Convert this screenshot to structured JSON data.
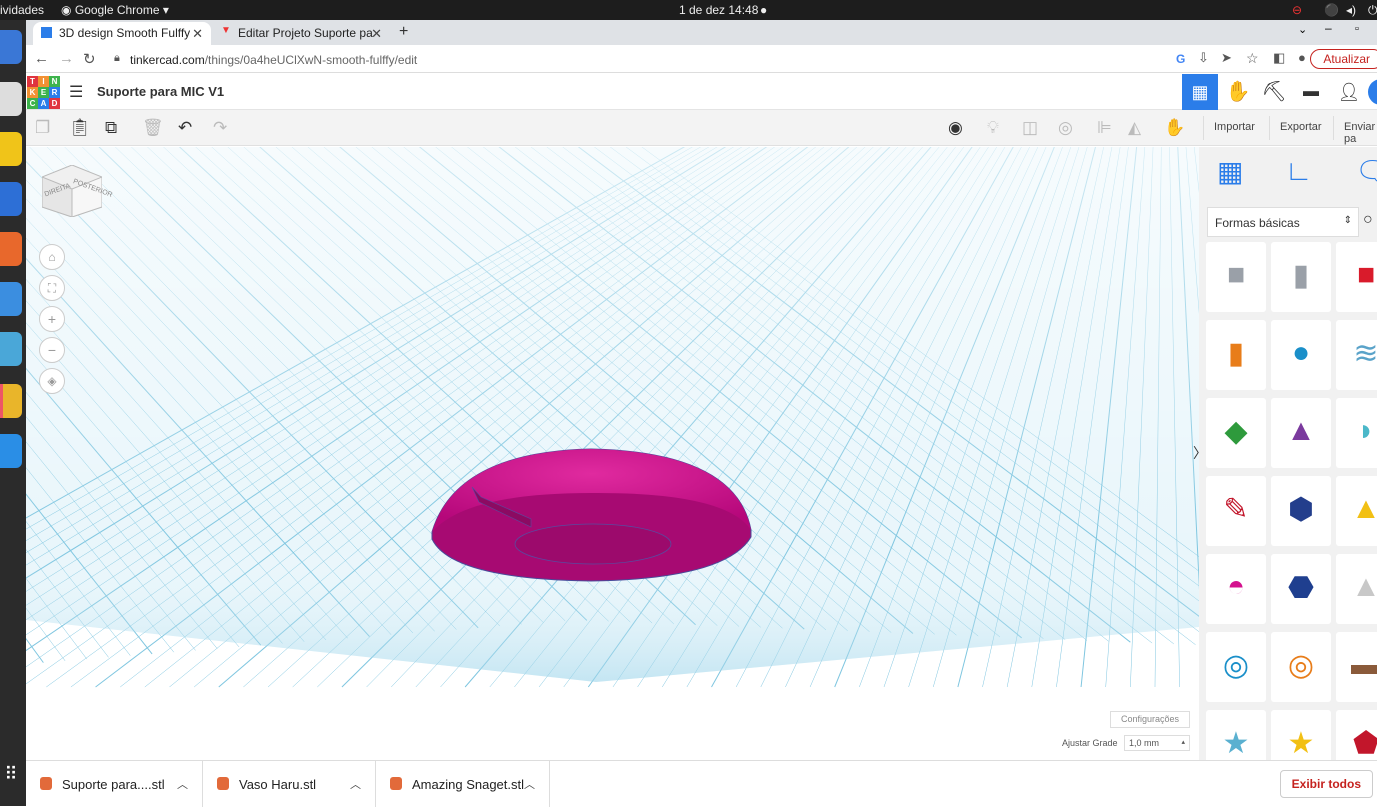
{
  "os": {
    "activities": "ividades",
    "app_menu": "Google Chrome ▾",
    "clock": "1 de dez  14:48"
  },
  "browser": {
    "tabs": [
      {
        "label": "3D design Smooth Fulffy"
      },
      {
        "label": "Editar Projeto Suporte pa"
      }
    ],
    "url_domain": "tinkercad.com",
    "url_path": "/things/0a4heUClXwN-smooth-fulffy/edit",
    "update_label": "Atualizar"
  },
  "app": {
    "logo_letters": [
      "T",
      "I",
      "N",
      "K",
      "E",
      "R",
      "C",
      "A",
      "D"
    ],
    "project_title": "Suporte para MIC V1"
  },
  "toolbar": {
    "import_label": "Importar",
    "export_label": "Exportar",
    "send_label": "Enviar pa"
  },
  "viewcube": {
    "left_face": "DIREITA",
    "front_face": "POSTERIOR"
  },
  "panel": {
    "category": "Formas básicas"
  },
  "workplane": {
    "settings_label": "Configurações",
    "snap_label": "Ajustar Grade",
    "snap_value": "1,0 mm"
  },
  "downloads": {
    "items": [
      {
        "label": "Suporte para....stl"
      },
      {
        "label": "Vaso Haru.stl"
      },
      {
        "label": "Amazing Snaget.stl"
      }
    ],
    "show_all": "Exibir todos"
  },
  "colors": {
    "accent": "#2b7de9",
    "shape_magenta": "#d4118e",
    "grid_line": "#7fc6e0",
    "update_red": "#c5221f"
  }
}
